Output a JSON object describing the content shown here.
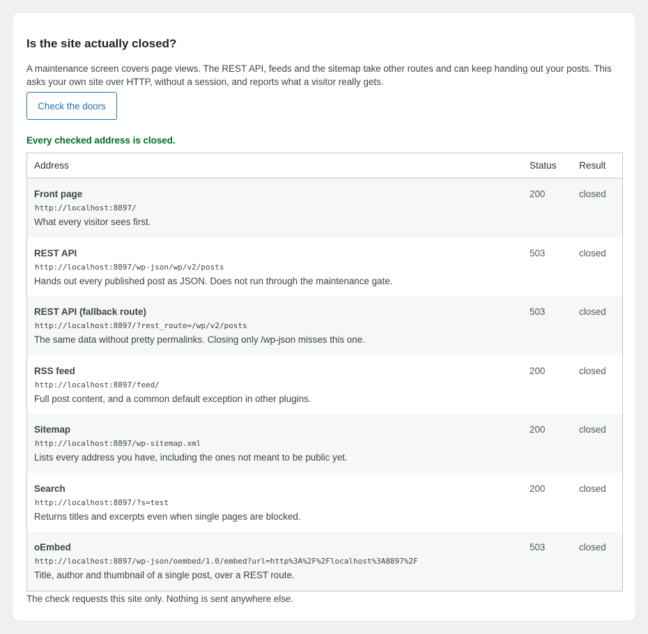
{
  "panel": {
    "title": "Is the site actually closed?",
    "description": "A maintenance screen covers page views. The REST API, feeds and the sitemap take other routes and can keep handing out your posts. This asks your own site over HTTP, without a session, and reports what a visitor really gets.",
    "button_label": "Check the doors",
    "status_message": "Every checked address is closed.",
    "status_color": "#00692a",
    "accent_color": "#2271b1",
    "footer": "The check requests this site only. Nothing is sent anywhere else."
  },
  "table": {
    "headers": {
      "address": "Address",
      "status": "Status",
      "result": "Result"
    },
    "rows": [
      {
        "name": "Front page",
        "url": "http://localhost:8897/",
        "note": "What every visitor sees first.",
        "status": "200",
        "result": "closed"
      },
      {
        "name": "REST API",
        "url": "http://localhost:8897/wp-json/wp/v2/posts",
        "note": "Hands out every published post as JSON. Does not run through the maintenance gate.",
        "status": "503",
        "result": "closed"
      },
      {
        "name": "REST API (fallback route)",
        "url": "http://localhost:8897/?rest_route=/wp/v2/posts",
        "note": "The same data without pretty permalinks. Closing only /wp-json misses this one.",
        "status": "503",
        "result": "closed"
      },
      {
        "name": "RSS feed",
        "url": "http://localhost:8897/feed/",
        "note": "Full post content, and a common default exception in other plugins.",
        "status": "200",
        "result": "closed"
      },
      {
        "name": "Sitemap",
        "url": "http://localhost:8897/wp-sitemap.xml",
        "note": "Lists every address you have, including the ones not meant to be public yet.",
        "status": "200",
        "result": "closed"
      },
      {
        "name": "Search",
        "url": "http://localhost:8897/?s=test",
        "note": "Returns titles and excerpts even when single pages are blocked.",
        "status": "200",
        "result": "closed"
      },
      {
        "name": "oEmbed",
        "url": "http://localhost:8897/wp-json/oembed/1.0/embed?url=http%3A%2F%2Flocalhost%3A8897%2F",
        "note": "Title, author and thumbnail of a single post, over a REST route.",
        "status": "503",
        "result": "closed"
      }
    ]
  }
}
